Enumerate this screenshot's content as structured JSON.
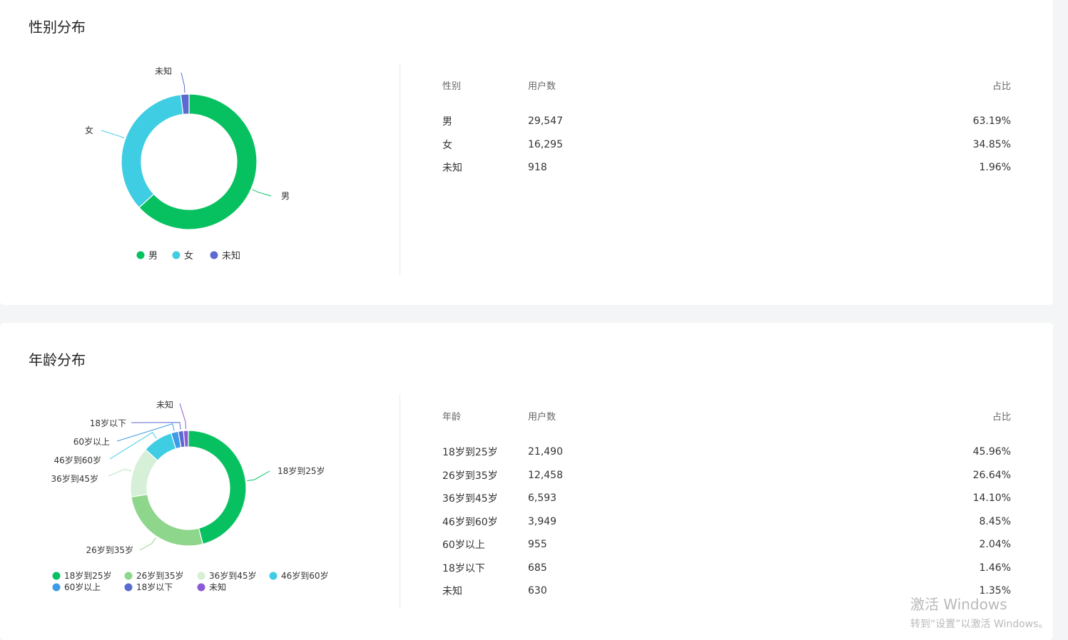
{
  "gender": {
    "title": "性别分布",
    "columns": [
      "性别",
      "用户数",
      "占比"
    ],
    "rows": [
      {
        "label": "男",
        "count": "29,547",
        "pct": "63.19%"
      },
      {
        "label": "女",
        "count": "16,295",
        "pct": "34.85%"
      },
      {
        "label": "未知",
        "count": "918",
        "pct": "1.96%"
      }
    ]
  },
  "age": {
    "title": "年龄分布",
    "columns": [
      "年龄",
      "用户数",
      "占比"
    ],
    "rows": [
      {
        "label": "18岁到25岁",
        "count": "21,490",
        "pct": "45.96%"
      },
      {
        "label": "26岁到35岁",
        "count": "12,458",
        "pct": "26.64%"
      },
      {
        "label": "36岁到45岁",
        "count": "6,593",
        "pct": "14.10%"
      },
      {
        "label": "46岁到60岁",
        "count": "3,949",
        "pct": "8.45%"
      },
      {
        "label": "60岁以上",
        "count": "955",
        "pct": "2.04%"
      },
      {
        "label": "18岁以下",
        "count": "685",
        "pct": "1.46%"
      },
      {
        "label": "未知",
        "count": "630",
        "pct": "1.35%"
      }
    ]
  },
  "chart_data": [
    {
      "type": "pie",
      "variant": "donut",
      "categories": [
        "男",
        "女",
        "未知"
      ],
      "values": [
        29547,
        16295,
        918
      ],
      "colors": [
        "#07c160",
        "#3fcde3",
        "#5b6ad0"
      ],
      "legend": "bottom"
    },
    {
      "type": "pie",
      "variant": "donut",
      "categories": [
        "18岁到25岁",
        "26岁到35岁",
        "36岁到45岁",
        "46岁到60岁",
        "60岁以上",
        "18岁以下",
        "未知"
      ],
      "values": [
        21490,
        12458,
        6593,
        3949,
        955,
        685,
        630
      ],
      "colors": [
        "#07c160",
        "#8ed68b",
        "#d5f0d6",
        "#3fcde3",
        "#3e9be8",
        "#5b6ad0",
        "#8a5bd6"
      ],
      "legend": "bottom"
    }
  ],
  "watermark": {
    "line1": "激活 Windows",
    "line2": "转到“设置”以激活 Windows。"
  }
}
